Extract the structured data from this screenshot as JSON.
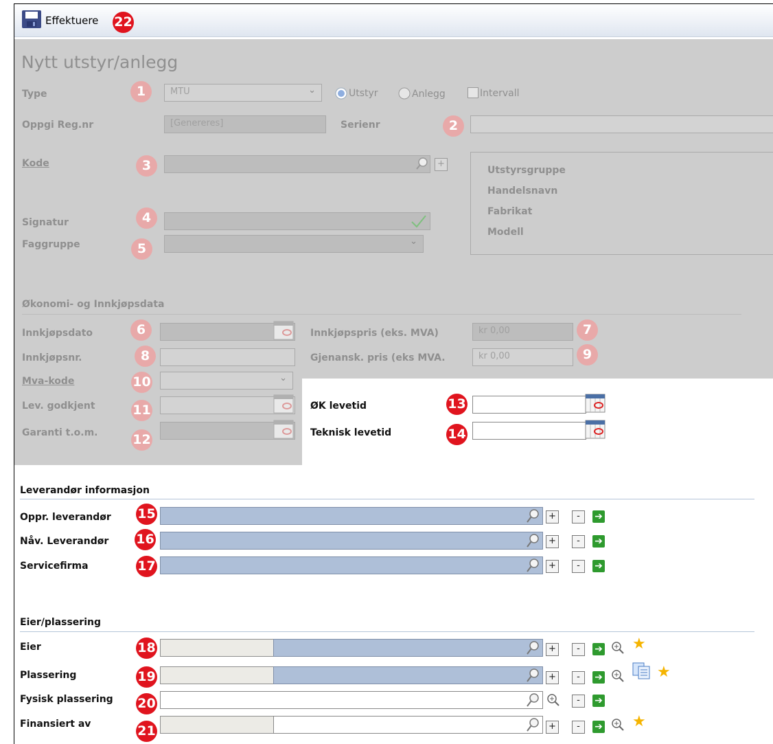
{
  "toolbar": {
    "execute_label": "Effektuere",
    "execute_badge": "22"
  },
  "form": {
    "title": "Nytt utstyr/anlegg",
    "type": {
      "label": "Type",
      "badge": "1",
      "value": "MTU",
      "radio_equipment": "Utstyr",
      "radio_facility": "Anlegg",
      "checkbox_interval": "Intervall"
    },
    "regnr": {
      "label": "Oppgi Reg.nr",
      "value": "[Genereres]"
    },
    "serial": {
      "label": "Serienr",
      "badge": "2",
      "value": ""
    },
    "code": {
      "label": "Kode",
      "badge": "3",
      "value": ""
    },
    "info_panel": {
      "lines": [
        "Utstyrsgruppe",
        "Handelsnavn",
        "Fabrikat",
        "Modell"
      ]
    },
    "signature": {
      "label": "Signatur",
      "badge": "4",
      "value": ""
    },
    "discipline": {
      "label": "Faggruppe",
      "badge": "5",
      "value": ""
    }
  },
  "economy": {
    "heading": "Økonomi- og Innkjøpsdata",
    "purchase_date": {
      "label": "Innkjøpsdato",
      "badge": "6",
      "value": ""
    },
    "purchase_price": {
      "label": "Innkjøpspris (eks. MVA)",
      "badge": "7",
      "value": "kr 0,00"
    },
    "purchase_no": {
      "label": "Innkjøpsnr.",
      "badge": "8",
      "value": ""
    },
    "replacement_price": {
      "label": "Gjenansk. pris (eks MVA.",
      "badge": "9",
      "value": "kr 0,00"
    },
    "vat_code": {
      "label": "Mva-kode",
      "badge": "10",
      "value": ""
    },
    "supplier_approved": {
      "label": "Lev. godkjent",
      "badge": "11",
      "value": ""
    },
    "warranty": {
      "label": "Garanti t.o.m.",
      "badge": "12",
      "value": ""
    },
    "econ_lifetime": {
      "label": "ØK levetid",
      "badge": "13",
      "value": ""
    },
    "tech_lifetime": {
      "label": "Teknisk levetid",
      "badge": "14",
      "value": ""
    }
  },
  "supplier": {
    "heading": "Leverandør informasjon",
    "rows": [
      {
        "label": "Oppr. leverandør",
        "badge": "15",
        "value": ""
      },
      {
        "label": "Nåv. Leverandør",
        "badge": "16",
        "value": ""
      },
      {
        "label": "Servicefirma",
        "badge": "17",
        "value": ""
      }
    ]
  },
  "owner": {
    "heading": "Eier/plassering",
    "rows": [
      {
        "label": "Eier",
        "badge": "18",
        "value": ""
      },
      {
        "label": "Plassering",
        "badge": "19",
        "value": ""
      },
      {
        "label": "Fysisk plassering",
        "badge": "20",
        "value": ""
      },
      {
        "label": "Finansiert av",
        "badge": "21",
        "value": ""
      }
    ]
  },
  "buttons": {
    "plus": "+",
    "minus": "-"
  },
  "colors": {
    "badge_red": "#e0141e",
    "field_blue": "#aebfd8",
    "disabled_overlay": "#cdcdcd"
  }
}
